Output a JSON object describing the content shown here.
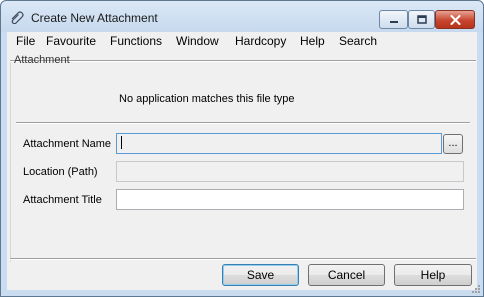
{
  "window": {
    "title": "Create New Attachment"
  },
  "icons": {
    "app": "paperclip-icon",
    "minimize": "minimize-icon",
    "maximize": "maximize-icon",
    "close": "close-icon",
    "grip": "resize-grip-icon"
  },
  "colors": {
    "titlebar": "#c6d9ee",
    "close_button": "#c7462f",
    "dialog_background": "#f0f0f0",
    "default_button_border": "#3c7fb1"
  },
  "menubar": {
    "items": [
      {
        "label": "File"
      },
      {
        "label": "Favourite"
      },
      {
        "label": "Functions"
      },
      {
        "label": "Window"
      },
      {
        "label": "Hardcopy"
      },
      {
        "label": "Help"
      },
      {
        "label": "Search"
      }
    ]
  },
  "attachment": {
    "section_label": "Attachment",
    "message": "No application matches this file type"
  },
  "fields": {
    "name": {
      "label": "Attachment Name",
      "value": "",
      "browse_label": "..."
    },
    "location": {
      "label": "Location (Path)",
      "value": ""
    },
    "title": {
      "label": "Attachment Title",
      "value": ""
    }
  },
  "buttons": {
    "save": "Save",
    "cancel": "Cancel",
    "help": "Help"
  }
}
